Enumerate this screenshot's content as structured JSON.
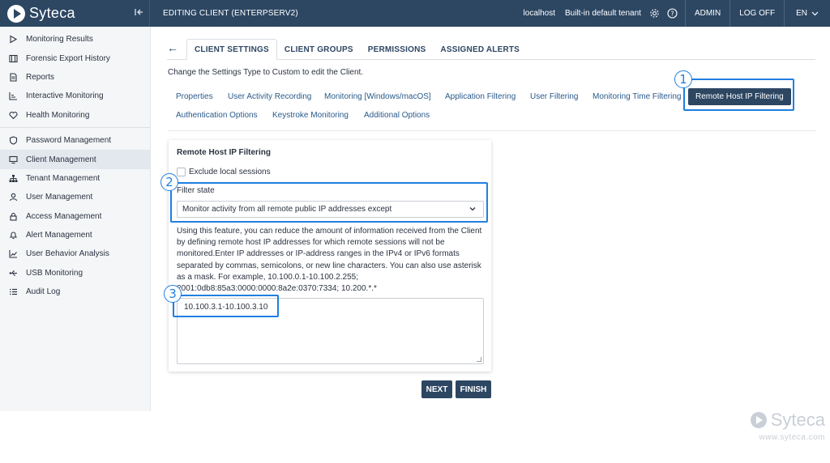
{
  "app": {
    "brand": "Syteca",
    "window_title": "EDITING CLIENT (ENTERPSERV2)"
  },
  "topbar": {
    "host": "localhost",
    "tenant": "Built-in default tenant",
    "admin_label": "ADMIN",
    "logoff_label": "LOG OFF",
    "language": "EN"
  },
  "sidebar": {
    "groups": [
      [
        {
          "label": "Monitoring Results",
          "icon": "play-icon"
        },
        {
          "label": "Forensic Export History",
          "icon": "film-icon"
        },
        {
          "label": "Reports",
          "icon": "document-icon"
        },
        {
          "label": "Interactive Monitoring",
          "icon": "chart-icon"
        },
        {
          "label": "Health Monitoring",
          "icon": "heart-icon"
        }
      ],
      [
        {
          "label": "Password Management",
          "icon": "shield-icon"
        },
        {
          "label": "Client Management",
          "icon": "monitor-icon",
          "active": true
        },
        {
          "label": "Tenant Management",
          "icon": "sitemap-icon"
        },
        {
          "label": "User Management",
          "icon": "user-icon"
        },
        {
          "label": "Access Management",
          "icon": "lock-icon"
        },
        {
          "label": "Alert Management",
          "icon": "bell-icon"
        },
        {
          "label": "User Behavior Analysis",
          "icon": "trend-icon"
        },
        {
          "label": "USB Monitoring",
          "icon": "usb-icon"
        },
        {
          "label": "Audit Log",
          "icon": "list-icon"
        }
      ]
    ]
  },
  "tabs": [
    "CLIENT SETTINGS",
    "CLIENT GROUPS",
    "PERMISSIONS",
    "ASSIGNED ALERTS"
  ],
  "hint": "Change the Settings Type to Custom to edit the Client.",
  "subtabs": {
    "row1": [
      "Properties",
      "User Activity Recording",
      "Monitoring [Windows/macOS]",
      "Application Filtering",
      "User Filtering",
      "Monitoring Time Filtering",
      "Remote Host IP Filtering"
    ],
    "row2": [
      "Authentication Options",
      "Keystroke Monitoring",
      "Additional Options"
    ]
  },
  "card": {
    "title": "Remote Host IP Filtering",
    "exclude_label": "Exclude local sessions",
    "filter_state_label": "Filter state",
    "filter_state_value": "Monitor activity from all remote public IP addresses except",
    "description": "Using this feature, you can reduce the amount of information received from the Client by defining remote host IP addresses for which remote sessions will not be monitored.Enter IP addresses or IP-address ranges in the IPv4 or IPv6 formats separated by commas, semicolons, or new line characters. You can also use asterisk as a mask. For example, 10.100.0.1-10.100.2.255; 2001:0db8:85a3:0000:0000:8a2e:0370:7334; 10.200.*.*",
    "ip_value": "10.100.3.1-10.100.3.10"
  },
  "buttons": {
    "next": "NEXT",
    "finish": "FINISH"
  },
  "callouts": [
    "1",
    "2",
    "3"
  ],
  "watermark": {
    "brand": "Syteca",
    "url": "www.syteca.com"
  },
  "colors": {
    "navy": "#2d4763",
    "accent": "#1f7fe0",
    "link": "#2a5a8a"
  }
}
